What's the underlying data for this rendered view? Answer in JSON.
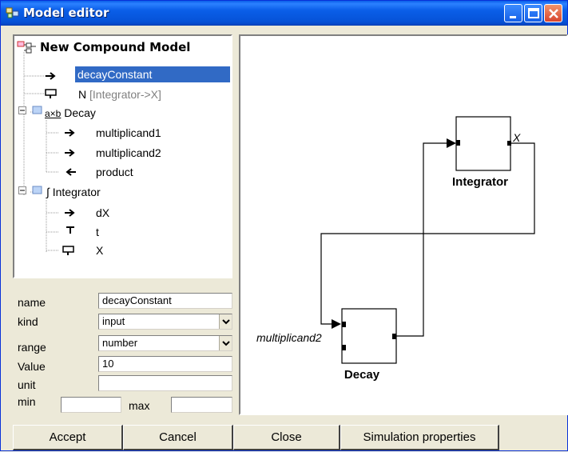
{
  "window": {
    "title": "Model editor"
  },
  "tree": {
    "root": "New Compound Model",
    "items": [
      {
        "label": "decayConstant",
        "suffix": ""
      },
      {
        "label": "N",
        "suffix": "[Integrator->X]"
      },
      {
        "label": "Decay",
        "prefix": "a×b"
      },
      {
        "label": "multiplicand1"
      },
      {
        "label": "multiplicand2"
      },
      {
        "label": "product"
      },
      {
        "label": "Integrator",
        "prefix": "∫"
      },
      {
        "label": "dX"
      },
      {
        "label": "t"
      },
      {
        "label": "X"
      }
    ]
  },
  "props": {
    "name_label": "name",
    "name_value": "decayConstant",
    "kind_label": "kind",
    "kind_value": "input",
    "range_label": "range",
    "range_value": "number",
    "value_label": "Value",
    "value_value": "10",
    "unit_label": "unit",
    "unit_value": "",
    "min_label": "min",
    "min_value": "",
    "max_label": "max",
    "max_value": ""
  },
  "diagram": {
    "integrator_label": "Integrator",
    "integrator_port": "X",
    "decay_label": "Decay",
    "decay_port": "multiplicand2"
  },
  "buttons": {
    "accept": "Accept",
    "cancel": "Cancel",
    "close": "Close",
    "simulation": "Simulation properties"
  }
}
